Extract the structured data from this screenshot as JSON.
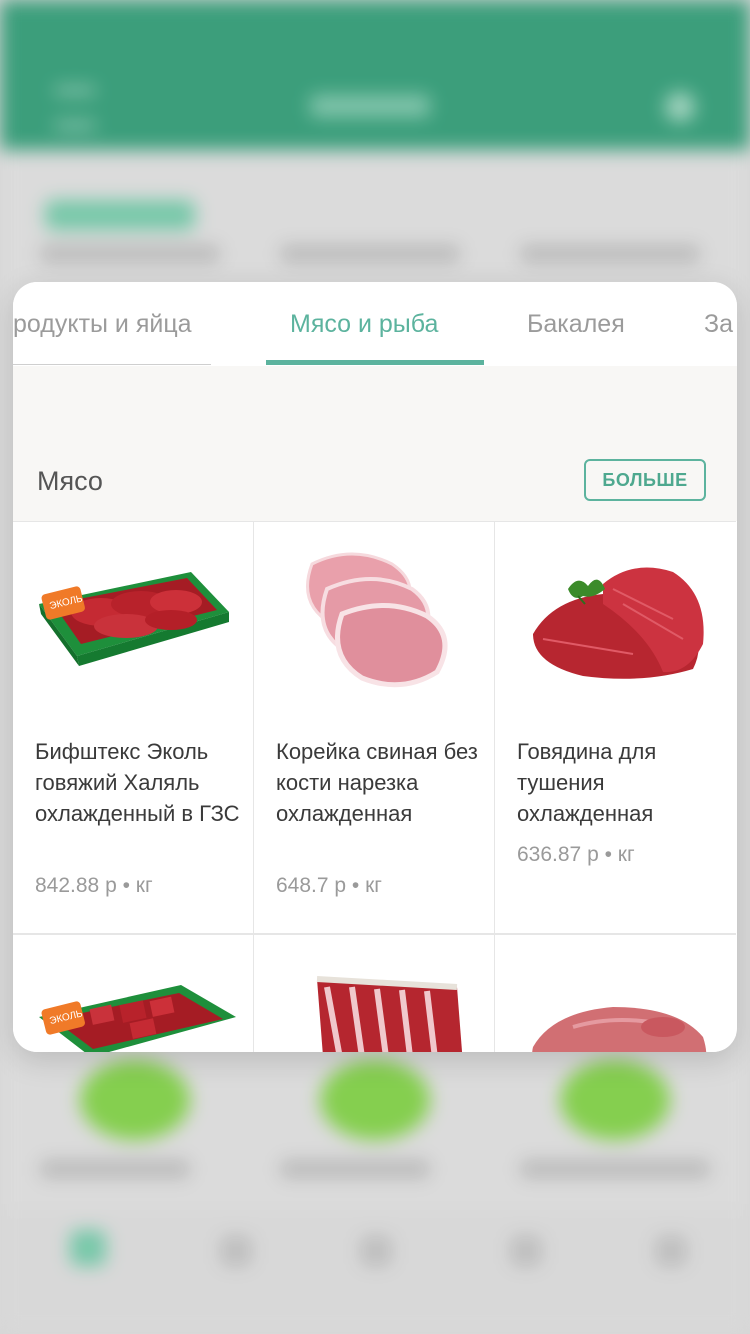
{
  "tabs": [
    {
      "label": "родукты и яйца",
      "active": false
    },
    {
      "label": "Мясо и рыба",
      "active": true
    },
    {
      "label": "Бакалея",
      "active": false
    },
    {
      "label": "За",
      "active": false
    }
  ],
  "section": {
    "title": "Мясо",
    "more_label": "БОЛЬШЕ"
  },
  "products": [
    {
      "name": "Бифштекс Эколь говяжий Халяль охлажденный в ГЗС",
      "price": "842.88 р • кг",
      "image": "meat-tray-image"
    },
    {
      "name": "Корейка свиная без кости нарезка охлажденная",
      "price": "648.7 р • кг",
      "image": "pork-loin-image"
    },
    {
      "name": "Говядина для тушения охлажденная",
      "price": "636.87 р • кг",
      "image": "beef-cut-image"
    },
    {
      "name": "",
      "price": "",
      "image": "meat-tray-cubes-image"
    },
    {
      "name": "",
      "price": "",
      "image": "beef-ribs-image"
    },
    {
      "name": "",
      "price": "",
      "image": "pork-piece-image"
    }
  ],
  "colors": {
    "accent": "#5cb39e",
    "header_bg": "#2f9a74",
    "tray_green": "#1e8f3b",
    "meat_red": "#c3232d"
  }
}
